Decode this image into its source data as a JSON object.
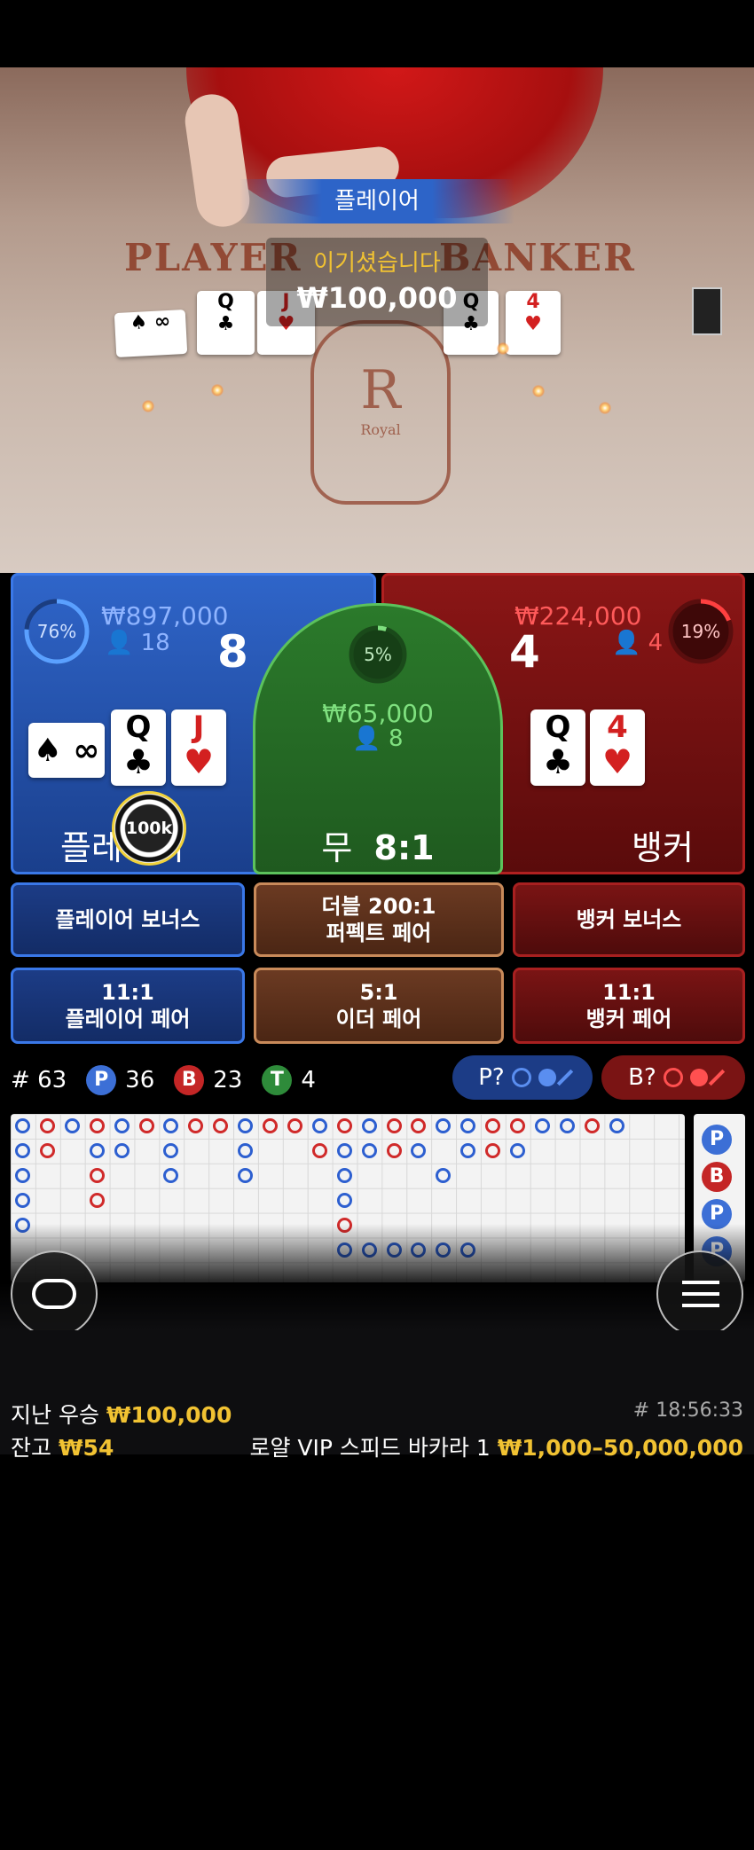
{
  "video": {
    "table_left": "PLAYER",
    "table_right": "BANKER",
    "logo_letter": "R",
    "logo_word": "Royal",
    "win_banner": "플레이어",
    "win_title": "이기셨습니다",
    "win_amount": "₩100,000",
    "player_cards": [
      {
        "rank": "∞",
        "suit": "♠"
      },
      {
        "rank": "Q",
        "suit": "♣"
      },
      {
        "rank": "J",
        "suit": "♥"
      }
    ],
    "banker_cards": [
      {
        "rank": "Q",
        "suit": "♣"
      },
      {
        "rank": "4",
        "suit": "♥"
      }
    ]
  },
  "player": {
    "percent": "76%",
    "percent_value": 0.76,
    "amount": "₩897,000",
    "count": "18",
    "score": "8",
    "label": "플레이어",
    "cards": [
      {
        "rank": "∞",
        "suit": "♠"
      },
      {
        "rank": "Q",
        "suit": "♣"
      },
      {
        "rank": "J",
        "suit": "♥"
      }
    ],
    "chip": "100k"
  },
  "tie": {
    "percent": "5%",
    "percent_value": 0.05,
    "amount": "₩65,000",
    "count": "8",
    "label": "무",
    "payout": "8:1"
  },
  "banker": {
    "percent": "19%",
    "percent_value": 0.19,
    "amount": "₩224,000",
    "count": "4",
    "score": "4",
    "label": "뱅커",
    "cards": [
      {
        "rank": "Q",
        "suit": "♣"
      },
      {
        "rank": "4",
        "suit": "♥"
      }
    ]
  },
  "side_bets": {
    "player_bonus": "플레이어 보너스",
    "perfect_pair_odds": "더블 200:1",
    "perfect_pair": "퍼펙트 페어",
    "banker_bonus": "뱅커 보너스",
    "player_pair_odds": "11:1",
    "player_pair": "플레이어 페어",
    "either_pair_odds": "5:1",
    "either_pair": "이더 페어",
    "banker_pair_odds": "11:1",
    "banker_pair": "뱅커 페어"
  },
  "stats": {
    "round_label": "#",
    "round": "63",
    "p_letter": "P",
    "p_count": "36",
    "b_letter": "B",
    "b_count": "23",
    "t_letter": "T",
    "t_count": "4",
    "p_predict": "P?",
    "b_predict": "B?"
  },
  "road_side": [
    "P",
    "B",
    "P",
    "P"
  ],
  "footer": {
    "last_win_label": "지난 우승",
    "last_win_amount": "₩100,000",
    "time": "# 18:56:33",
    "balance_label": "잔고",
    "balance_amount": "₩54",
    "table_name": "로얄 VIP 스피드 바카라 1",
    "limits": "₩1,000–50,000,000"
  },
  "colors": {
    "player_blue": "#2f65c9",
    "banker_red": "#8b1616",
    "tie_green": "#2b7a2b",
    "accent_yellow": "#f1c232"
  }
}
